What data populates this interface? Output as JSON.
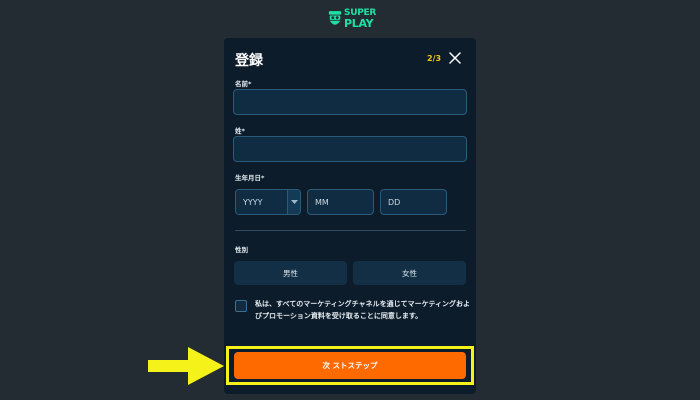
{
  "brand": {
    "line1": "SUPER",
    "line2": "PLAY"
  },
  "modal": {
    "title": "登録",
    "step": "2/3"
  },
  "form": {
    "first_name_label": "名前*",
    "first_name_value": "",
    "last_name_label": "姓*",
    "last_name_value": "",
    "dob_label": "生年月日*",
    "year_placeholder": "YYYY",
    "month_placeholder": "MM",
    "day_placeholder": "DD",
    "gender_label": "性別",
    "gender_male": "男性",
    "gender_female": "女性",
    "consent_text": "私は、すべてのマーケティングチャネルを通じてマーケティングおよびプロモーション資料を受け取ることに同意します。",
    "next_button": "次 ストステップ"
  },
  "colors": {
    "page_bg": "#242c33",
    "modal_bg": "#0c1c2b",
    "brand": "#1fe0a2",
    "step": "#f5c518",
    "cta": "#ff6a00",
    "highlight": "#f5f21a"
  },
  "icons": {
    "close": "close-icon",
    "dropdown": "chevron-down-icon",
    "annotation": "arrow-right-icon"
  }
}
